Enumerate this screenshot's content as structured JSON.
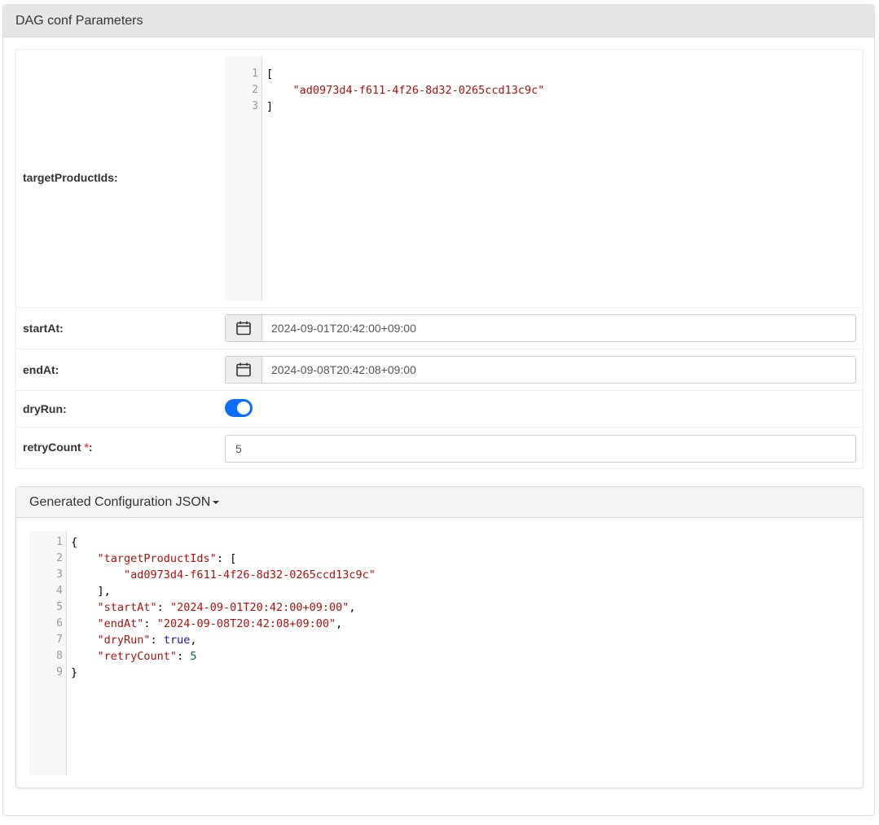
{
  "panel": {
    "title": "DAG conf Parameters"
  },
  "params": {
    "targetProductIds": {
      "label": "targetProductIds:",
      "lines": [
        "1",
        "2",
        "3"
      ],
      "code": [
        "[",
        "    ",
        "]"
      ],
      "value": "\"ad0973d4-f611-4f26-8d32-0265ccd13c9c\""
    },
    "startAt": {
      "label": "startAt:",
      "value": "2024-09-01T20:42:00+09:00",
      "icon": "calendar-icon"
    },
    "endAt": {
      "label": "endAt:",
      "value": "2024-09-08T20:42:08+09:00",
      "icon": "calendar-icon"
    },
    "dryRun": {
      "label": "dryRun:",
      "checked": true
    },
    "retryCount": {
      "label": "retryCount",
      "required_mark": "*",
      "colon": ":",
      "value": "5"
    }
  },
  "generated": {
    "title": "Generated Configuration JSON",
    "lines": [
      "1",
      "2",
      "3",
      "4",
      "5",
      "6",
      "7",
      "8",
      "9"
    ],
    "json": {
      "open": "{",
      "k_target": "\"targetProductIds\"",
      "open_arr": ": [",
      "v_id": "\"ad0973d4-f611-4f26-8d32-0265ccd13c9c\"",
      "close_arr": "],",
      "k_start": "\"startAt\"",
      "v_start": "\"2024-09-01T20:42:00+09:00\"",
      "k_end": "\"endAt\"",
      "v_end": "\"2024-09-08T20:42:08+09:00\"",
      "k_dry": "\"dryRun\"",
      "v_dry": "true",
      "k_retry": "\"retryCount\"",
      "v_retry": "5",
      "sep": ": ",
      "comma": ",",
      "close": "}"
    }
  },
  "colors": {
    "toggle_on": "#0d6efd",
    "string": "#aa1111",
    "atom": "#221199",
    "number": "#116644",
    "required": "#d9534f"
  }
}
